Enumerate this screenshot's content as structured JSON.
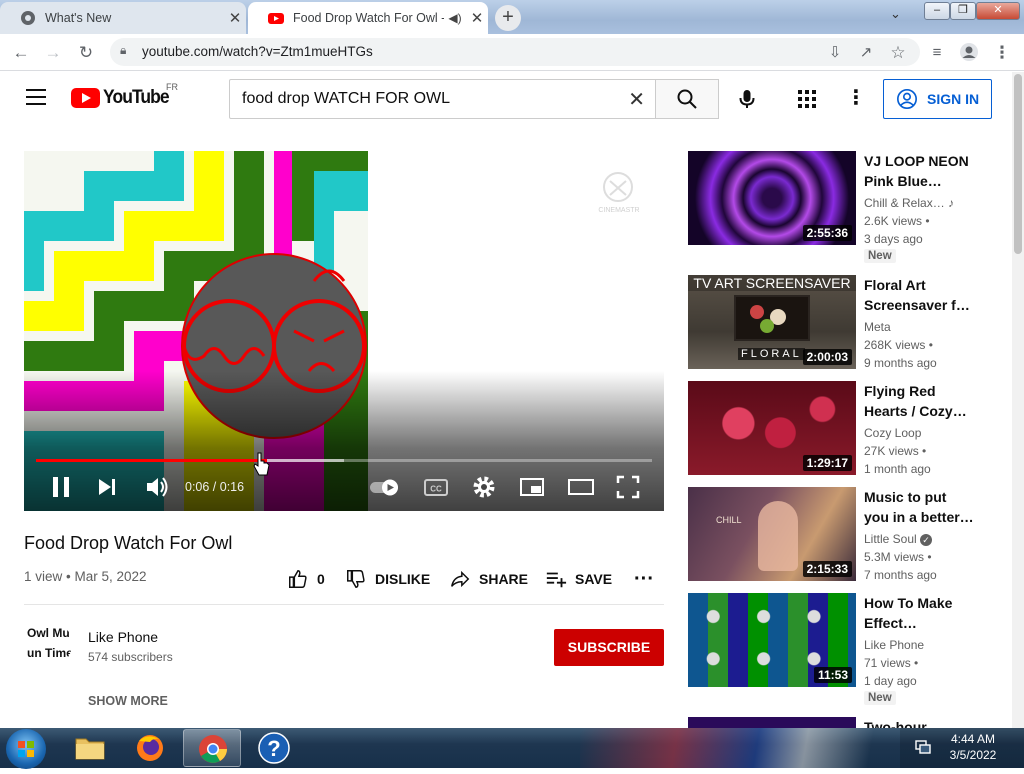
{
  "browser": {
    "tabs": [
      {
        "title": "What's New",
        "active": false
      },
      {
        "title": "Food Drop Watch For Owl - ",
        "active": true
      }
    ],
    "url": "youtube.com/watch?v=Ztm1mueHTGs"
  },
  "youtube": {
    "logo_text": "YouTube",
    "country": "FR",
    "search_value": "food drop WATCH FOR OWL",
    "signin_label": "SIGN IN"
  },
  "player": {
    "time": "0:06 / 0:16",
    "progress_fraction": 0.375,
    "buffered_fraction": 0.5,
    "watermark": "CINEMASTR"
  },
  "video": {
    "title": "Food Drop Watch For Owl",
    "meta": "1 view • Mar 5, 2022",
    "likes": "0",
    "dislike_label": "DISLIKE",
    "share_label": "SHARE",
    "save_label": "SAVE"
  },
  "channel": {
    "avatar_lines": [
      "Owl Mu",
      "un Time"
    ],
    "name": "Like Phone",
    "subscribers": "574 subscribers",
    "subscribe_label": "SUBSCRIBE",
    "show_more": "SHOW MORE"
  },
  "related": [
    {
      "title": "VJ LOOP NEON Pink Blue…",
      "channel": "Chill & Relax…",
      "views": "2.6K views •",
      "age": "3 days ago",
      "badge": "New",
      "duration": "2:55:36",
      "thumb_text": ""
    },
    {
      "title": "Floral Art Screensaver f…",
      "channel": "Meta",
      "views": "268K views •",
      "age": "9 months ago",
      "badge": "",
      "duration": "2:00:03",
      "thumb_text": "TV ART SCREENSAVER",
      "thumb_text2": "FLORAL"
    },
    {
      "title": "Flying Red Hearts / Cozy…",
      "channel": "Cozy Loop",
      "views": "27K views •",
      "age": "1 month ago",
      "badge": "",
      "duration": "1:29:17",
      "thumb_text": ""
    },
    {
      "title": "Music to put you in a better…",
      "channel": "Little Soul",
      "views": "5.3M views •",
      "age": "7 months ago",
      "badge": "",
      "duration": "2:15:33",
      "thumb_text": "CHILL"
    },
    {
      "title": "How To Make Effect…",
      "channel": "Like Phone",
      "views": "71 views •",
      "age": "1 day ago",
      "badge": "New",
      "duration": "11:53",
      "thumb_text": ""
    },
    {
      "title": "Two-hour",
      "channel": "",
      "views": "",
      "age": "",
      "badge": "",
      "duration": "",
      "thumb_text": ""
    }
  ],
  "taskbar": {
    "time": "4:44 AM",
    "date": "3/5/2022"
  },
  "colors": {
    "youtube_red": "#ff0000",
    "subscribe_red": "#cc0000",
    "signin_blue": "#065fd4"
  }
}
